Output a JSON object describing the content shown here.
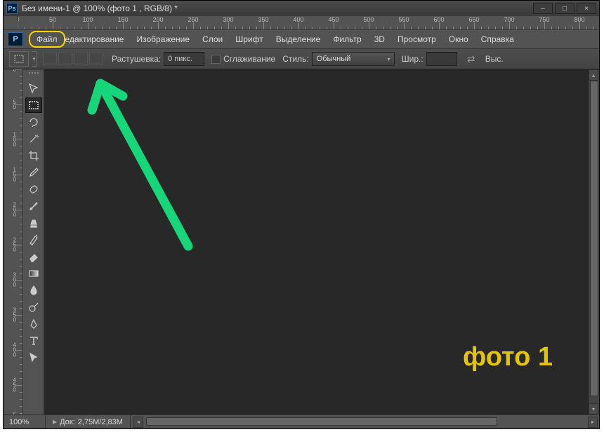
{
  "title": "Без имени-1 @ 100% (фото 1 , RGB/8) *",
  "window_buttons": {
    "minimize": "–",
    "maximize": "□",
    "close": "×"
  },
  "menu": {
    "items": [
      "Файл",
      "Редактирование",
      "Изображение",
      "Слои",
      "Шрифт",
      "Выделение",
      "Фильтр",
      "3D",
      "Просмотр",
      "Окно",
      "Справка"
    ],
    "highlighted_index": 0
  },
  "options": {
    "feather_label": "Растушевка:",
    "feather_value": "0 пикс.",
    "antialias_label": "Сглаживание",
    "style_label": "Стиль:",
    "style_value": "Обычный",
    "width_label": "Шир.:",
    "width_value": "",
    "height_label": "Выс."
  },
  "ruler": {
    "h_marks": [
      0,
      50,
      100,
      150,
      200,
      250,
      300,
      350,
      400,
      450,
      500,
      550,
      600,
      650,
      700,
      750,
      800
    ],
    "v_marks": [
      0,
      50,
      100,
      150,
      200,
      250,
      300,
      350,
      400,
      450
    ]
  },
  "tools": [
    {
      "name": "move-tool"
    },
    {
      "name": "marquee-tool",
      "active": true
    },
    {
      "name": "lasso-tool"
    },
    {
      "name": "magic-wand-tool"
    },
    {
      "name": "crop-tool"
    },
    {
      "name": "eyedropper-tool"
    },
    {
      "name": "healing-brush-tool"
    },
    {
      "name": "brush-tool"
    },
    {
      "name": "clone-stamp-tool"
    },
    {
      "name": "history-brush-tool"
    },
    {
      "name": "eraser-tool"
    },
    {
      "name": "gradient-tool"
    },
    {
      "name": "blur-tool"
    },
    {
      "name": "dodge-tool"
    },
    {
      "name": "pen-tool"
    },
    {
      "name": "type-tool"
    },
    {
      "name": "path-selection-tool"
    }
  ],
  "status": {
    "zoom": "100%",
    "doc_label": "Док:",
    "doc_size": "2,75M/2,83M"
  },
  "annotation_label": "фото 1"
}
